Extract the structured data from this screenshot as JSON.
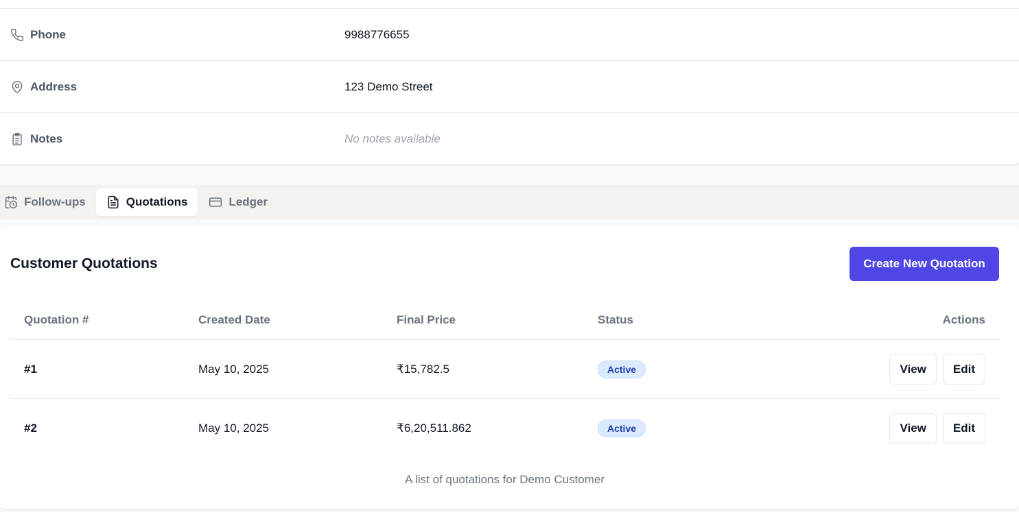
{
  "details": {
    "rows": [
      {
        "label": "Phone",
        "value": "9988776655"
      },
      {
        "label": "Address",
        "value": "123 Demo Street"
      },
      {
        "label": "Notes",
        "value": "No notes available"
      }
    ]
  },
  "tabs": [
    {
      "label": "Follow-ups",
      "icon": "calendar-clock-icon",
      "active": false
    },
    {
      "label": "Quotations",
      "icon": "document-icon",
      "active": true
    },
    {
      "label": "Ledger",
      "icon": "credit-card-icon",
      "active": false
    }
  ],
  "quotations": {
    "title": "Customer Quotations",
    "create_button": "Create New Quotation",
    "columns": [
      "Quotation #",
      "Created Date",
      "Final Price",
      "Status",
      "Actions"
    ],
    "rows": [
      {
        "number": "#1",
        "date": "May 10, 2025",
        "price": "₹15,782.5",
        "status": "Active",
        "view": "View",
        "edit": "Edit"
      },
      {
        "number": "#2",
        "date": "May 10, 2025",
        "price": "₹6,20,511.862",
        "status": "Active",
        "view": "View",
        "edit": "Edit"
      }
    ],
    "caption": "A list of quotations for Demo Customer"
  },
  "colors": {
    "accent": "#4f46e5",
    "badge_bg": "#dbeafe",
    "badge_text": "#1e40af"
  }
}
